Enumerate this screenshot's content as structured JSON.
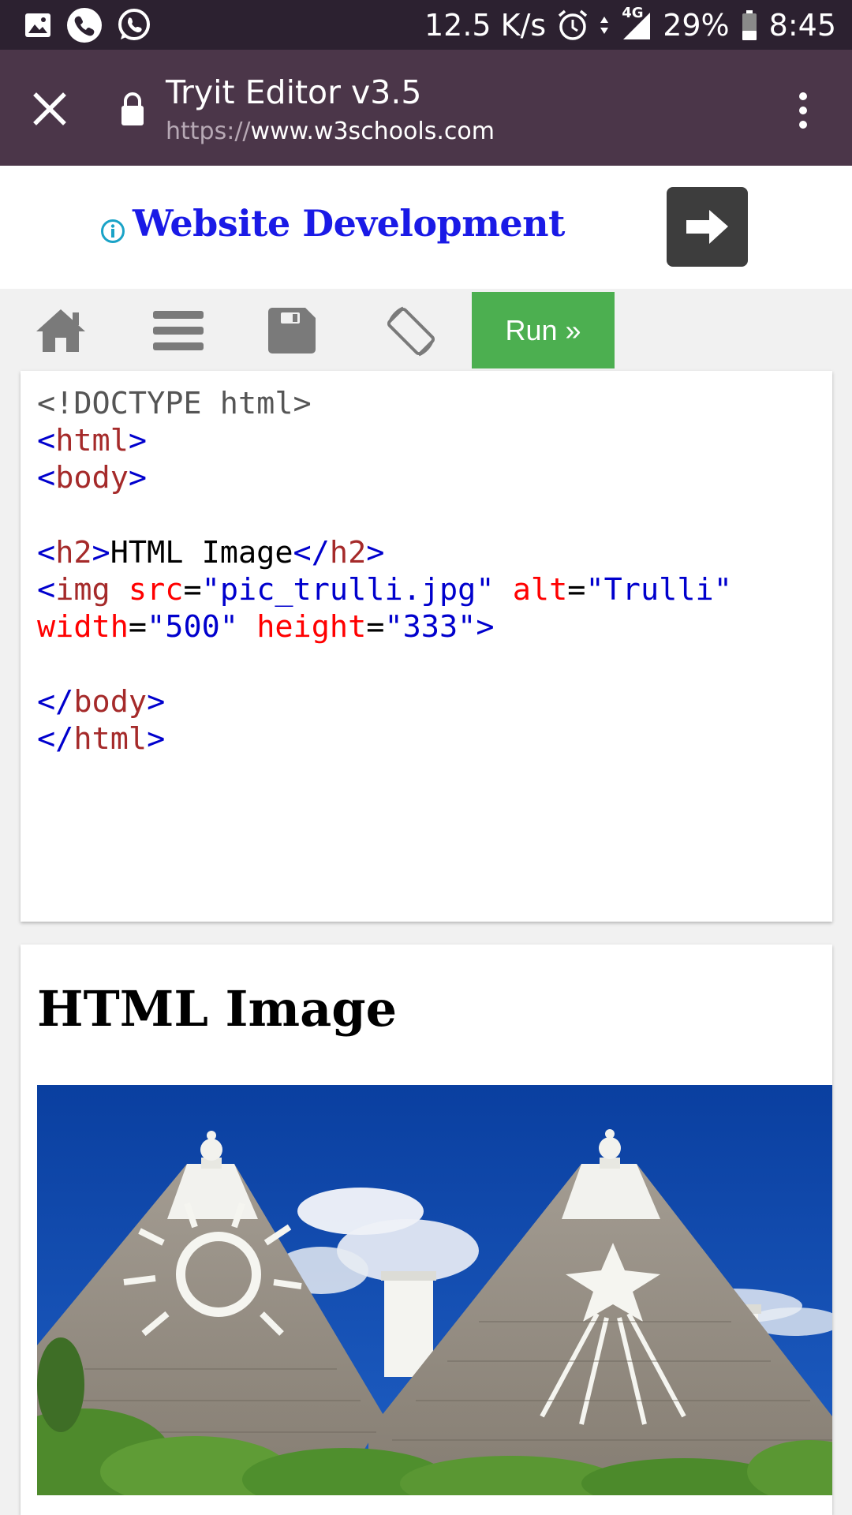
{
  "status_bar": {
    "net_speed": "12.5 K/s",
    "network": "4G",
    "battery": "29%",
    "time": "8:45",
    "left_icons": [
      "gallery-icon",
      "phone-icon",
      "whatsapp-icon"
    ],
    "right_icons": [
      "alarm-icon",
      "data-arrows-icon",
      "signal-icon",
      "battery-icon"
    ]
  },
  "tab_bar": {
    "title": "Tryit Editor v3.5",
    "url_scheme": "https://",
    "url_host": "www.w3schools.com"
  },
  "ad": {
    "text": "Website Development"
  },
  "toolbar": {
    "run_label": "Run »",
    "icons": [
      "home-icon",
      "menu-icon",
      "save-icon",
      "rotate-icon"
    ]
  },
  "code": {
    "doctype": "<!DOCTYPE html>",
    "h2_text": "HTML Image",
    "img_src": "\"pic_trulli.jpg\"",
    "img_alt": "\"Trulli\"",
    "img_width": "\"500\"",
    "img_height": "\"333\""
  },
  "result": {
    "heading": "HTML Image"
  },
  "colors": {
    "status_bar": "#2c2130",
    "tab_bar": "#4b3649",
    "run_button": "#4caf50",
    "ad_text": "#1a1ae6",
    "code_tag": "#a52a2a",
    "code_attr": "#ff0000",
    "code_value": "#0000cd"
  }
}
